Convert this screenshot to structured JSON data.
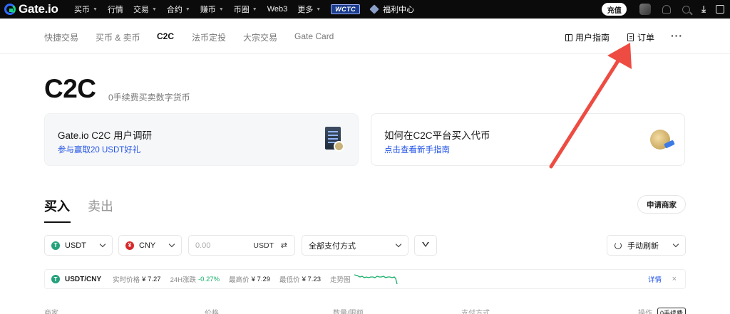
{
  "topnav": {
    "logo": "Gate.io",
    "items": [
      {
        "label": "买币",
        "caret": true
      },
      {
        "label": "行情",
        "caret": false
      },
      {
        "label": "交易",
        "caret": true
      },
      {
        "label": "合约",
        "caret": true
      },
      {
        "label": "赚币",
        "caret": true
      },
      {
        "label": "币圈",
        "caret": true
      },
      {
        "label": "Web3",
        "caret": false
      },
      {
        "label": "更多",
        "caret": true
      }
    ],
    "badge": "WCTC",
    "welfare": "福利中心",
    "deposit": "充值"
  },
  "subnav": {
    "tabs": [
      "快捷交易",
      "买币 & 卖币",
      "C2C",
      "法币定投",
      "大宗交易",
      "Gate Card"
    ],
    "active": "C2C",
    "user_guide": "用户指南",
    "orders": "订单",
    "more": "···"
  },
  "page": {
    "title": "C2C",
    "subtitle": "0手续费买卖数字货币"
  },
  "cards": [
    {
      "title": "Gate.io C2C 用户调研",
      "link": "参与赢取20 USDT好礼"
    },
    {
      "title": "如何在C2C平台买入代币",
      "link": "点击查看新手指南"
    }
  ],
  "trade": {
    "buy": "买入",
    "sell": "卖出",
    "apply_merchant": "申请商家"
  },
  "filters": {
    "crypto": "USDT",
    "fiat": "CNY",
    "amount_placeholder": "0.00",
    "amount_unit": "USDT",
    "payment": "全部支付方式",
    "refresh": "手动刷新"
  },
  "ticker": {
    "pair": "USDT/CNY",
    "realtime_label": "实时价格",
    "realtime": "¥ 7.27",
    "change_label": "24H涨跌",
    "change": "-0.27%",
    "high_label": "最高价",
    "high": "¥ 7.29",
    "low_label": "最低价",
    "low": "¥ 7.23",
    "trend_label": "走势图",
    "detail": "详情",
    "close": "×"
  },
  "table": {
    "headers": [
      "商家",
      "价格",
      "数量/限额",
      "支付方式",
      "操作"
    ],
    "zero_fee": "0手续费"
  },
  "colors": {
    "accent_blue": "#2354e6",
    "up_green": "#18b06a",
    "arrow_red": "#ee4c42"
  }
}
